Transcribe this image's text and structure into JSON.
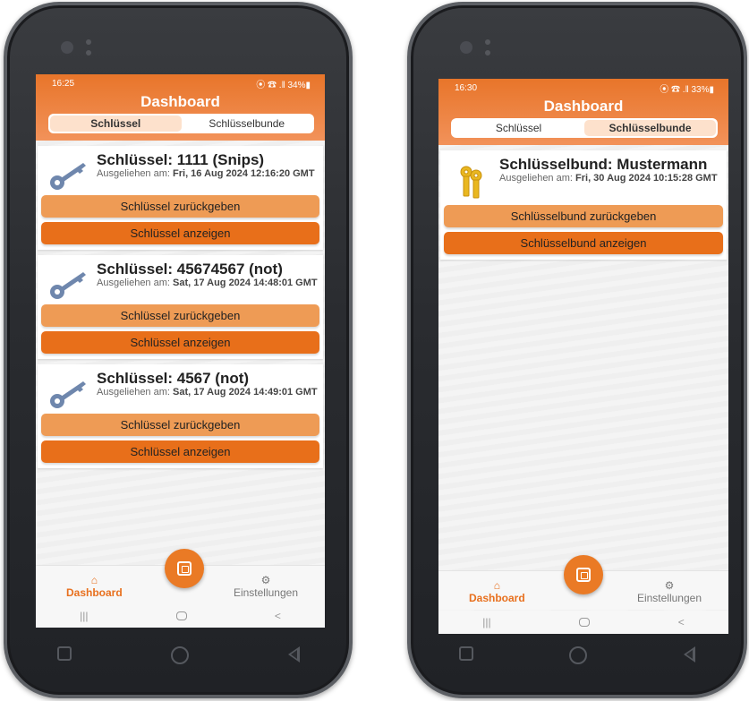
{
  "colors": {
    "accent": "#e86f1a",
    "accent_light": "#ee9b55",
    "header_top": "#e8752a",
    "header_bottom": "#f2925a"
  },
  "left": {
    "status": {
      "time": "16:25",
      "icons": "⦿ ☎ .‖ 34%▮"
    },
    "title": "Dashboard",
    "tabs": [
      {
        "label": "Schlüssel",
        "active": true
      },
      {
        "label": "Schlüsselbunde",
        "active": false
      }
    ],
    "cards": [
      {
        "title": "Schlüssel: 1111 (Snips)",
        "prefix": "Ausgeliehen am:",
        "date": "Fri, 16 Aug 2024 12:16:20 GMT",
        "btn_return": "Schlüssel zurückgeben",
        "btn_show": "Schlüssel anzeigen",
        "icon": "key-icon"
      },
      {
        "title": "Schlüssel: 45674567 (not)",
        "prefix": "Ausgeliehen am:",
        "date": "Sat, 17 Aug 2024 14:48:01 GMT",
        "btn_return": "Schlüssel zurückgeben",
        "btn_show": "Schlüssel anzeigen",
        "icon": "key-icon"
      },
      {
        "title": "Schlüssel: 4567 (not)",
        "prefix": "Ausgeliehen am:",
        "date": "Sat, 17 Aug 2024 14:49:01 GMT",
        "btn_return": "Schlüssel zurückgeben",
        "btn_show": "Schlüssel anzeigen",
        "icon": "key-icon"
      }
    ],
    "nav": {
      "dashboard": "Dashboard",
      "settings": "Einstellungen"
    }
  },
  "right": {
    "status": {
      "time": "16:30",
      "icons": "⦿ ☎ .‖ 33%▮"
    },
    "title": "Dashboard",
    "tabs": [
      {
        "label": "Schlüssel",
        "active": false
      },
      {
        "label": "Schlüsselbunde",
        "active": true
      }
    ],
    "cards": [
      {
        "title": "Schlüsselbund: Mustermann",
        "prefix": "Ausgeliehen am:",
        "date": "Fri, 30 Aug 2024 10:15:28 GMT",
        "btn_return": "Schlüsselbund zurückgeben",
        "btn_show": "Schlüsselbund anzeigen",
        "icon": "keychain-icon"
      }
    ],
    "nav": {
      "dashboard": "Dashboard",
      "settings": "Einstellungen"
    }
  }
}
